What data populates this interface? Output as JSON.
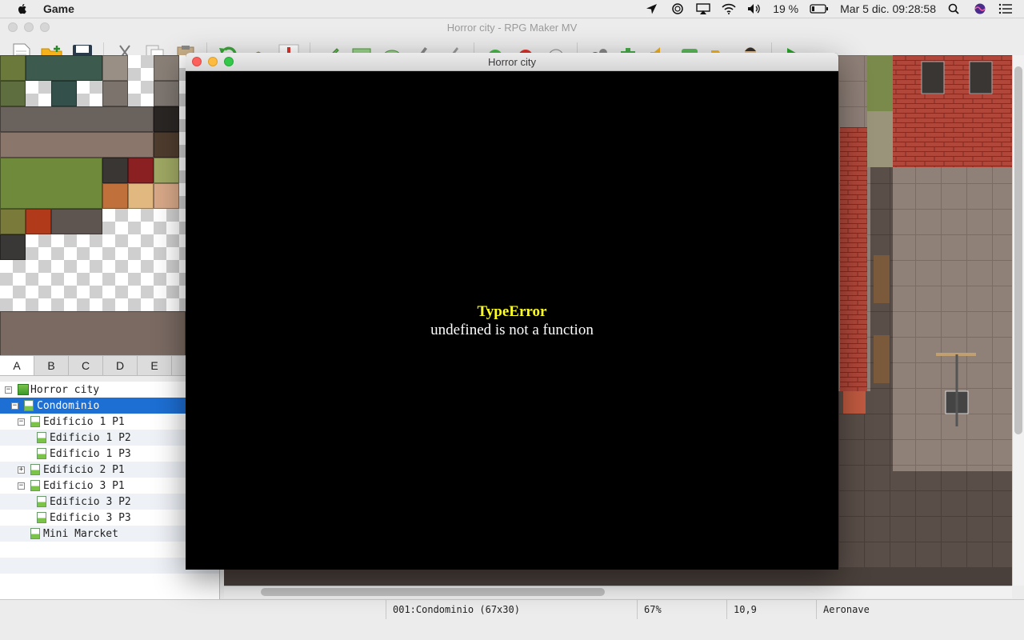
{
  "menubar": {
    "app_name": "Game",
    "battery": "19 %",
    "clock": "Mar 5 dic.  09:28:58"
  },
  "editor": {
    "title": "Horror city - RPG Maker MV",
    "toolbar_icons": [
      "new-project-icon",
      "open-project-icon",
      "save-icon",
      "cut-icon",
      "copy-icon",
      "paste-icon",
      "undo-icon",
      "layer-icon",
      "event-icon",
      "pencil-icon",
      "rectangle-icon",
      "ellipse-icon",
      "fill-icon",
      "shadow-pen-icon",
      "zoom-in-icon",
      "zoom-out-icon",
      "actual-size-icon",
      "database-icon",
      "plugin-icon",
      "sound-icon",
      "event-searcher-icon",
      "resource-icon",
      "character-generator-icon",
      "playtest-icon"
    ]
  },
  "tileset": {
    "tabs": [
      "A",
      "B",
      "C",
      "D",
      "E"
    ],
    "active_tab": "A"
  },
  "map_tree": {
    "rows": [
      {
        "label": "Horror city",
        "indent": 0,
        "toggle": "−",
        "root": true
      },
      {
        "label": "Condominio",
        "indent": 1,
        "toggle": "−",
        "selected": true
      },
      {
        "label": "Edificio 1 P1",
        "indent": 2,
        "toggle": "−"
      },
      {
        "label": "Edificio 1 P2",
        "indent": 3,
        "toggle": ""
      },
      {
        "label": "Edificio 1 P3",
        "indent": 3,
        "toggle": ""
      },
      {
        "label": "Edificio 2 P1",
        "indent": 2,
        "toggle": "+"
      },
      {
        "label": "Edificio 3 P1",
        "indent": 2,
        "toggle": "−"
      },
      {
        "label": "Edificio 3 P2",
        "indent": 3,
        "toggle": ""
      },
      {
        "label": "Edificio 3 P3",
        "indent": 3,
        "toggle": ""
      },
      {
        "label": "Mini Marcket",
        "indent": 2,
        "toggle": ""
      }
    ]
  },
  "status": {
    "map": "001:Condominio (67x30)",
    "zoom": "67%",
    "coords": "10,9",
    "vehicle": "Aeronave"
  },
  "game_window": {
    "title": "Horror city",
    "error_title": "TypeError",
    "error_message": "undefined is not a function"
  },
  "colors": {
    "selection": "#1d6fd4",
    "error_title": "#ffff20",
    "close": "#fc605c",
    "minimize": "#fdbc40",
    "zoom": "#34c84a"
  }
}
